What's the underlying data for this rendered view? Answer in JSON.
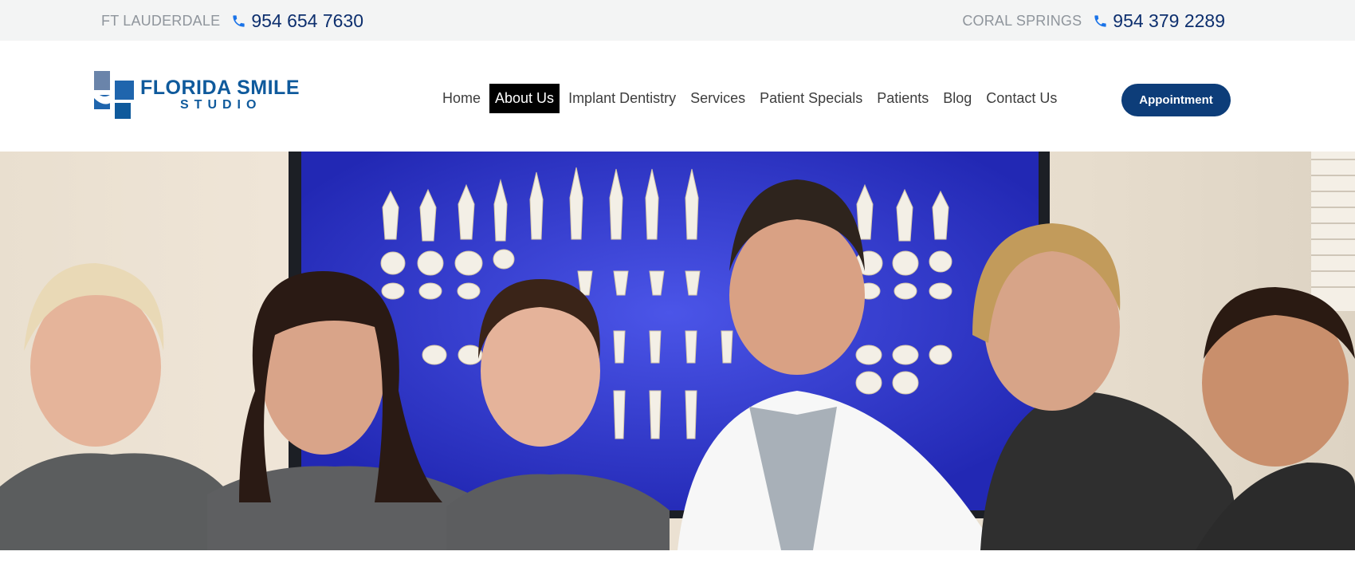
{
  "topbar": {
    "left": {
      "city": "FT LAUDERDALE",
      "phone": "954 654 7630"
    },
    "right": {
      "city": "CORAL SPRINGS",
      "phone": "954 379 2289"
    }
  },
  "logo": {
    "line1": "FLORIDA SMILE",
    "line2": "STUDIO"
  },
  "nav": {
    "items": [
      {
        "label": "Home"
      },
      {
        "label": "About Us",
        "active": true
      },
      {
        "label": "Implant Dentistry"
      },
      {
        "label": "Services"
      },
      {
        "label": "Patient Specials"
      },
      {
        "label": "Patients"
      },
      {
        "label": "Blog"
      },
      {
        "label": "Contact Us"
      }
    ],
    "appointment_label": "Appointment"
  },
  "hero": {
    "image": "team-photo"
  },
  "colors": {
    "brand_navy": "#0d3d79",
    "phone_icon": "#1a73e8",
    "topbar_bg": "#f3f4f4",
    "active_nav_bg": "#000000"
  }
}
